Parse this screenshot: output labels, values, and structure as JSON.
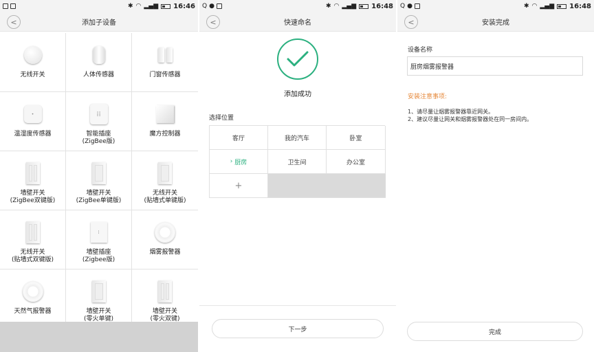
{
  "status": {
    "s1_time": "16:46",
    "s2_time": "16:48",
    "s3_time": "16:48"
  },
  "screen1": {
    "title": "添加子设备",
    "devices": [
      {
        "line1": "无线开关",
        "line2": "",
        "icon": "round-button-icon"
      },
      {
        "line1": "人体传感器",
        "line2": "",
        "icon": "motion-sensor-icon"
      },
      {
        "line1": "门窗传感器",
        "line2": "",
        "icon": "door-sensor-icon"
      },
      {
        "line1": "温湿度传感器",
        "line2": "",
        "icon": "temperature-sensor-icon"
      },
      {
        "line1": "智能插座",
        "line2": "(ZigBee版)",
        "icon": "smart-plug-icon"
      },
      {
        "line1": "魔方控制器",
        "line2": "",
        "icon": "cube-controller-icon"
      },
      {
        "line1": "墙壁开关",
        "line2": "(ZigBee双键版)",
        "icon": "wall-switch-icon"
      },
      {
        "line1": "墙壁开关",
        "line2": "(ZigBee单键版)",
        "icon": "wall-switch-icon"
      },
      {
        "line1": "无线开关",
        "line2": "(贴墙式单键版)",
        "icon": "wall-switch-icon"
      },
      {
        "line1": "无线开关",
        "line2": "(贴墙式双键版)",
        "icon": "wall-switch-icon"
      },
      {
        "line1": "墙壁插座",
        "line2": "(Zigbee版)",
        "icon": "wall-socket-icon"
      },
      {
        "line1": "烟雾报警器",
        "line2": "",
        "icon": "smoke-alarm-icon"
      },
      {
        "line1": "天然气报警器",
        "line2": "",
        "icon": "gas-alarm-icon"
      },
      {
        "line1": "墙壁开关",
        "line2": "(零火单键)",
        "icon": "wall-switch-icon"
      },
      {
        "line1": "墙壁开关",
        "line2": "(零火双键)",
        "icon": "wall-switch-icon"
      }
    ]
  },
  "screen2": {
    "title": "快速命名",
    "success": "添加成功",
    "location_label": "选择位置",
    "locations": [
      "客厅",
      "我的汽车",
      "卧室",
      "厨房",
      "卫生间",
      "办公室"
    ],
    "selected_marker": "›",
    "add_label": "+",
    "next_button": "下一步"
  },
  "screen3": {
    "title": "安装完成",
    "name_label": "设备名称",
    "name_value": "厨房烟雾报警器",
    "notice_title": "安装注意事项:",
    "notes": [
      "1、请尽量让烟雾报警器靠近网关。",
      "2、建议尽量让网关和烟雾报警器处在同一房间内。"
    ],
    "done_button": "完成"
  },
  "colors": {
    "accent_green": "#2bb07f",
    "notice_orange": "#e6883a"
  }
}
